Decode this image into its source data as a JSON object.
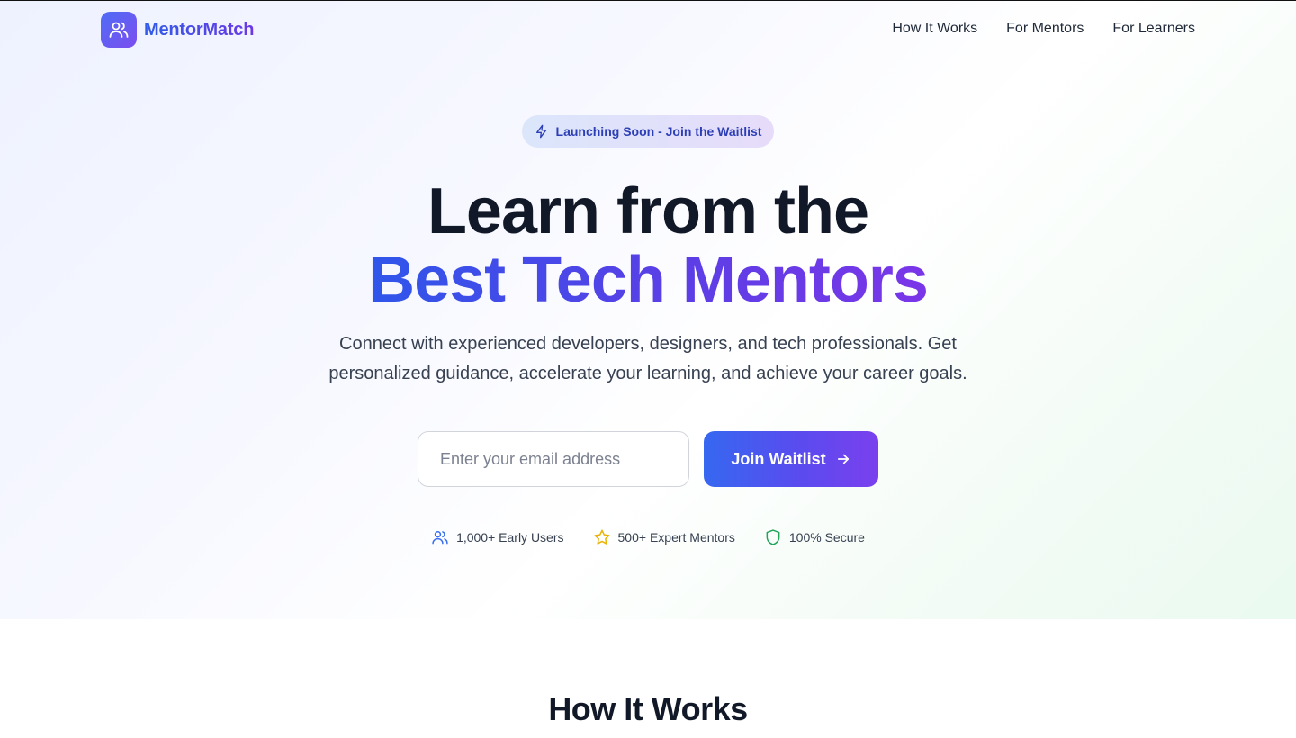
{
  "brand": {
    "name": "MentorMatch",
    "logo_icon": "users-icon"
  },
  "nav": {
    "items": [
      {
        "label": "How It Works"
      },
      {
        "label": "For Mentors"
      },
      {
        "label": "For Learners"
      }
    ]
  },
  "hero": {
    "badge": {
      "icon": "zap-icon",
      "label": "Launching Soon - Join the Waitlist"
    },
    "headline_line1": "Learn from the",
    "headline_line2": "Best Tech Mentors",
    "subtext": "Connect with experienced developers, designers, and tech professionals. Get personalized guidance, accelerate your learning, and achieve your career goals.",
    "form": {
      "email_placeholder": "Enter your email address",
      "email_value": "",
      "button_label": "Join Waitlist",
      "button_icon": "arrow-right-icon"
    },
    "stats": [
      {
        "icon": "users-icon",
        "label": "1,000+ Early Users",
        "color": "#3b6ff0"
      },
      {
        "icon": "star-icon",
        "label": "500+ Expert Mentors",
        "color": "#eab308"
      },
      {
        "icon": "shield-icon",
        "label": "100% Secure",
        "color": "#22a55b"
      }
    ]
  },
  "sections": {
    "how_it_works_title": "How It Works"
  },
  "colors": {
    "brand_gradient_start": "#3668f0",
    "brand_gradient_end": "#7a40ee",
    "text_primary": "#111827",
    "text_secondary": "#374151"
  }
}
